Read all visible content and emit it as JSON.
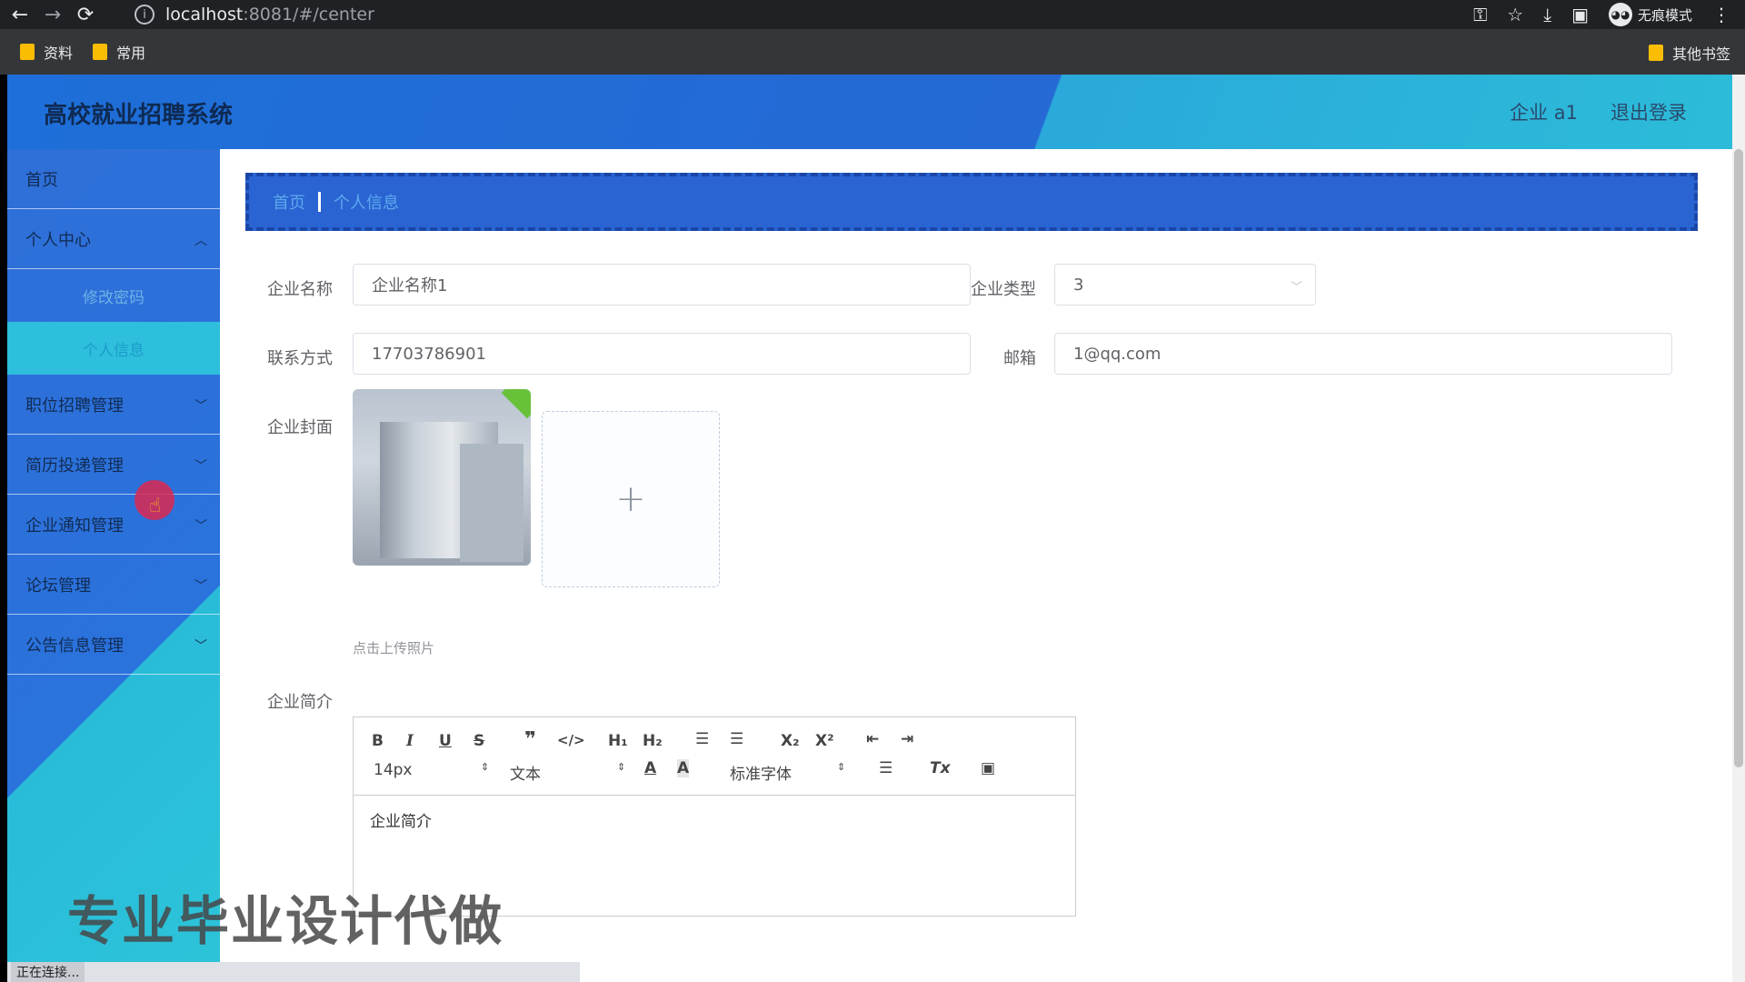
{
  "browser": {
    "url_host": "localhost",
    "url_rest": ":8081/#/center",
    "incognito_label": "无痕模式",
    "bookmarks": [
      "资料",
      "常用"
    ],
    "other_bookmarks": "其他书签",
    "status": "正在连接..."
  },
  "header": {
    "title": "高校就业招聘系统",
    "user": "企业 a1",
    "logout": "退出登录"
  },
  "sidebar": {
    "home": "首页",
    "personal_center": "个人中心",
    "change_password": "修改密码",
    "personal_info": "个人信息",
    "items": [
      "职位招聘管理",
      "简历投递管理",
      "企业通知管理",
      "论坛管理",
      "公告信息管理"
    ]
  },
  "breadcrumb": {
    "home": "首页",
    "current": "个人信息"
  },
  "form": {
    "company_name_label": "企业名称",
    "company_name_value": "企业名称1",
    "company_type_label": "企业类型",
    "company_type_value": "3",
    "contact_label": "联系方式",
    "contact_value": "17703786901",
    "email_label": "邮箱",
    "email_value": "1@qq.com",
    "cover_label": "企业封面",
    "upload_plus": "+",
    "upload_tip": "点击上传照片",
    "intro_label": "企业简介",
    "editor_placeholder": "企业简介",
    "font_size": "14px",
    "text_style": "文本",
    "font_family": "标准字体"
  },
  "watermark": "专业毕业设计代做"
}
